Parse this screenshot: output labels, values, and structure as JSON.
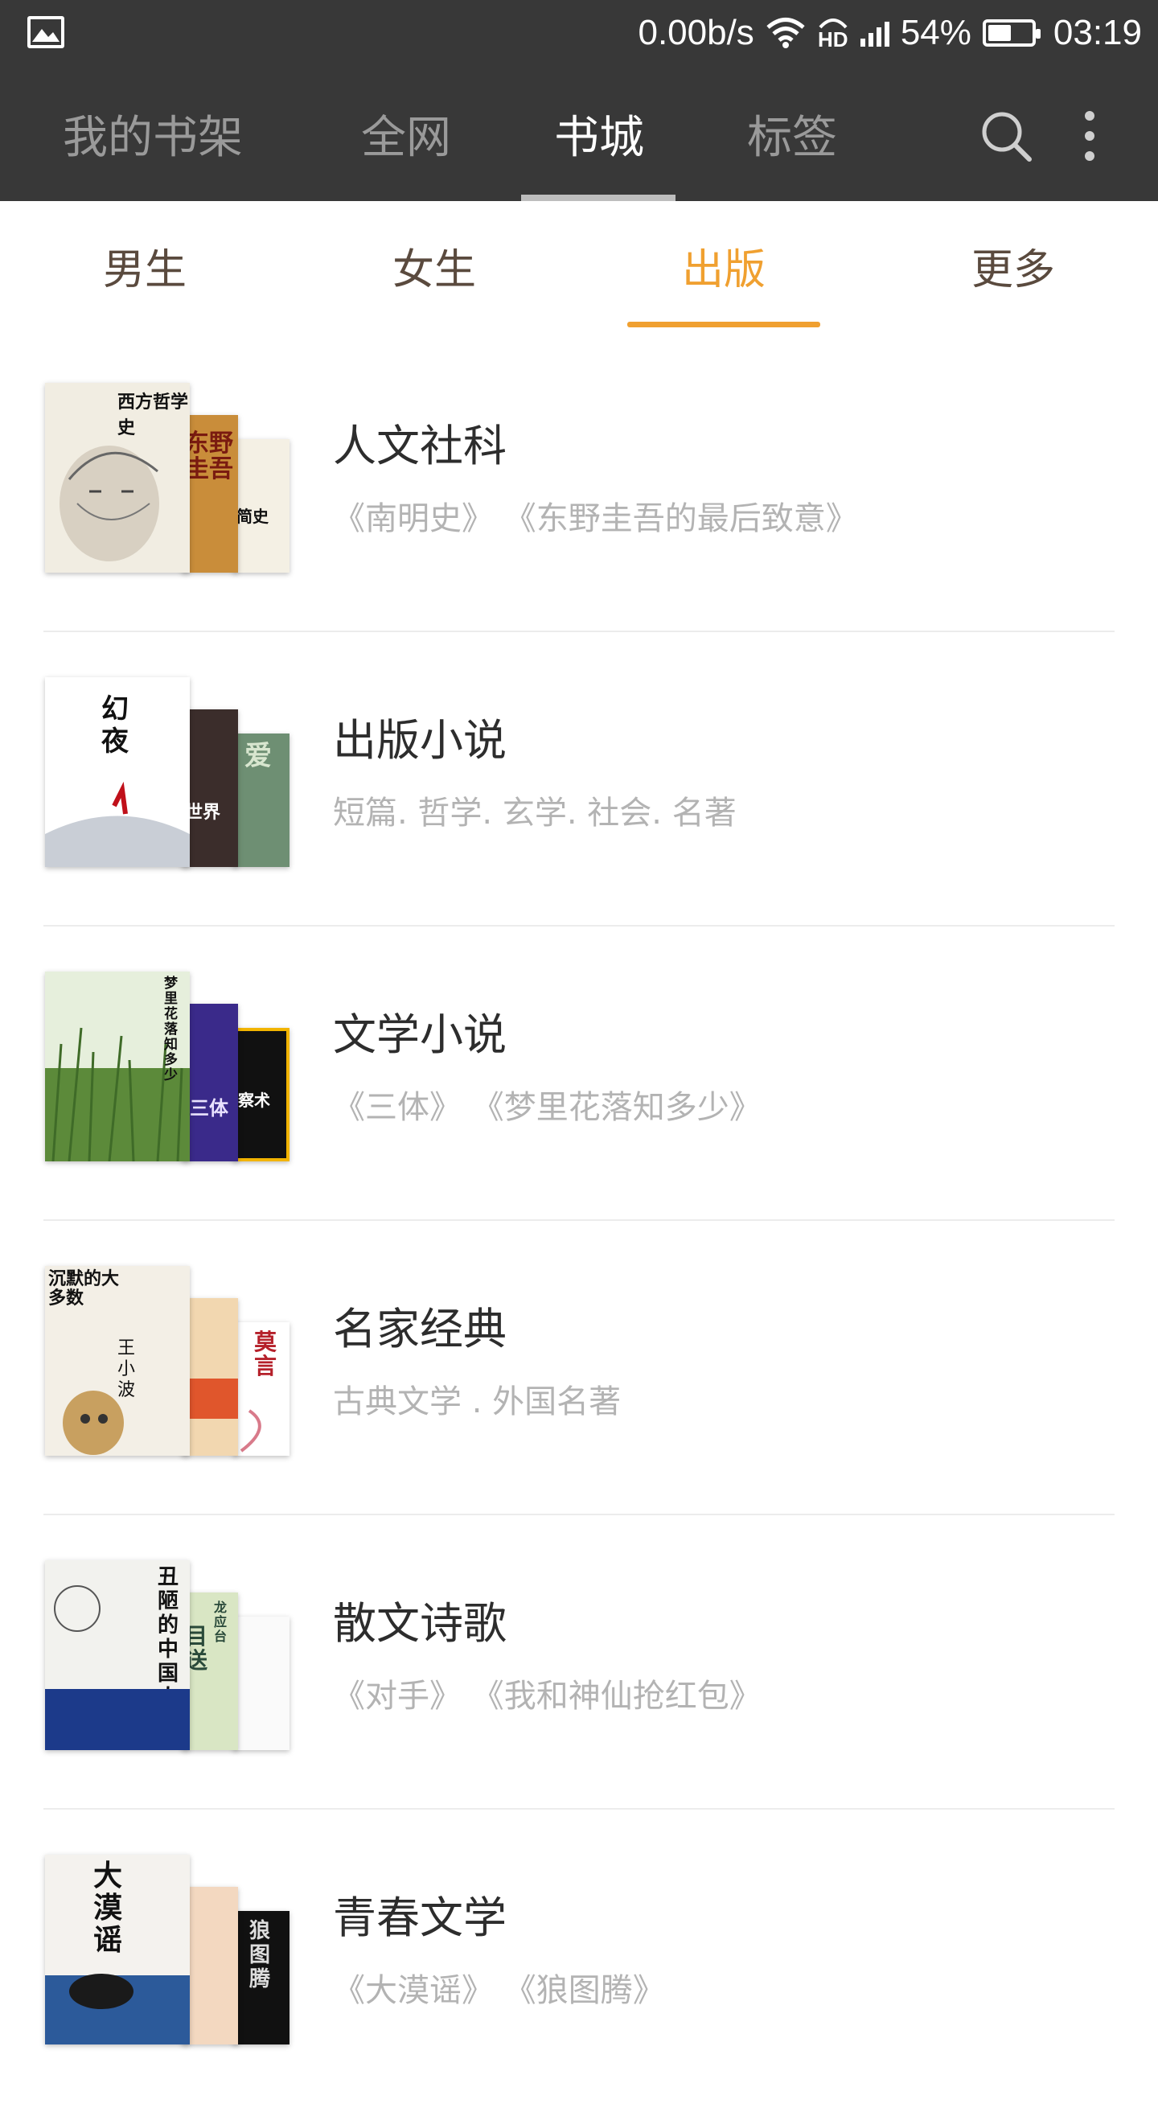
{
  "status_bar": {
    "net_speed": "0.00b/s",
    "hd_label": "HD",
    "battery_percent": "54%",
    "battery_level": 0.54,
    "time": "03:19",
    "icons": [
      "image-icon",
      "wifi-icon",
      "hd-call-icon",
      "signal-icon",
      "battery-icon"
    ]
  },
  "header": {
    "tabs": [
      "我的书架",
      "全网",
      "书城",
      "标签"
    ],
    "active_tab": "书城",
    "icons": [
      "search-icon",
      "more-vert-icon"
    ]
  },
  "categories": {
    "tabs": [
      "男生",
      "女生",
      "出版",
      "更多"
    ],
    "active_tab": "出版",
    "accent": "#f0a030"
  },
  "list": [
    {
      "title": "人文社科",
      "subtitle": "《南明史》 《东野圭吾的最后致意》",
      "cover_texts": [
        "西方哲学史",
        "东野圭吾",
        "简史"
      ]
    },
    {
      "title": "出版小说",
      "subtitle": "短篇. 哲学. 玄学. 社会. 名著",
      "cover_texts": [
        "幻夜",
        "世界",
        "爱"
      ]
    },
    {
      "title": "文学小说",
      "subtitle": "《三体》 《梦里花落知多少》",
      "cover_texts": [
        "梦里花落知多少",
        "三体",
        "察术"
      ]
    },
    {
      "title": "名家经典",
      "subtitle": "古典文学 . 外国名著",
      "cover_texts": [
        "沉默的大多数",
        "王小波",
        "莫言"
      ]
    },
    {
      "title": "散文诗歌",
      "subtitle": "《对手》 《我和神仙抢红包》",
      "cover_texts": [
        "丑陋的中国人",
        "目送",
        "龙应台"
      ]
    },
    {
      "title": "青春文学",
      "subtitle": "《大漠谣》 《狼图腾》",
      "cover_texts": [
        "大漠谣",
        "狼图腾"
      ]
    }
  ]
}
